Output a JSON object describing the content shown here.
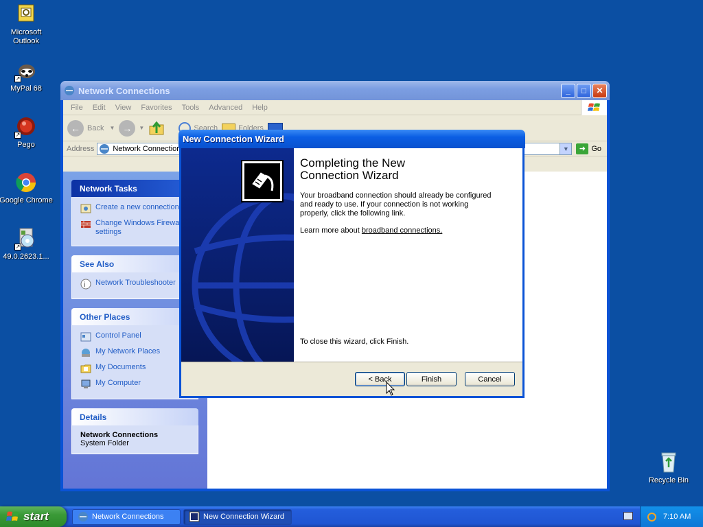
{
  "desktop": {
    "icons": [
      {
        "label": "Microsoft Outlook",
        "icon": "outlook-icon"
      },
      {
        "label": "MyPal 68",
        "icon": "mypal-icon"
      },
      {
        "label": "Pego",
        "icon": "pego-icon"
      },
      {
        "label": "Google Chrome",
        "icon": "chrome-icon"
      },
      {
        "label": "49.0.2623.1...",
        "icon": "installer-icon"
      },
      {
        "label": "Recycle Bin",
        "icon": "recycle-bin-icon"
      }
    ]
  },
  "explorer": {
    "title": "Network Connections",
    "menu": [
      "File",
      "Edit",
      "View",
      "Favorites",
      "Tools",
      "Advanced",
      "Help"
    ],
    "toolbar": {
      "back": "Back",
      "search": "Search",
      "folders": "Folders"
    },
    "address": {
      "label": "Address",
      "value": "Network Connections",
      "go": "Go"
    },
    "network_tasks": {
      "title": "Network Tasks",
      "items": [
        "Create a new connection",
        "Change Windows Firewall settings"
      ]
    },
    "see_also": {
      "title": "See Also",
      "items": [
        "Network Troubleshooter"
      ]
    },
    "other_places": {
      "title": "Other Places",
      "items": [
        "Control Panel",
        "My Network Places",
        "My Documents",
        "My Computer"
      ]
    },
    "details": {
      "title": "Details",
      "name": "Network Connections",
      "type": "System Folder"
    }
  },
  "wizard": {
    "title": "New Connection Wizard",
    "heading": "Completing the New Connection Wizard",
    "body": "Your broadband connection should already be configured and ready to use. If your connection is not working properly, click the following link.",
    "learn_prefix": "Learn more about ",
    "learn_link": "broadband connections.",
    "close_text": "To close this wizard, click Finish.",
    "buttons": {
      "back": "< Back",
      "finish": "Finish",
      "cancel": "Cancel"
    }
  },
  "taskbar": {
    "start": "start",
    "items": [
      {
        "label": "Network Connections",
        "active": false
      },
      {
        "label": "New Connection Wizard",
        "active": true
      }
    ],
    "clock": "7:10 AM"
  },
  "colors": {
    "desktop": "#0b4fa3",
    "titlebar": "#0a53d6",
    "link": "#215dc6"
  }
}
